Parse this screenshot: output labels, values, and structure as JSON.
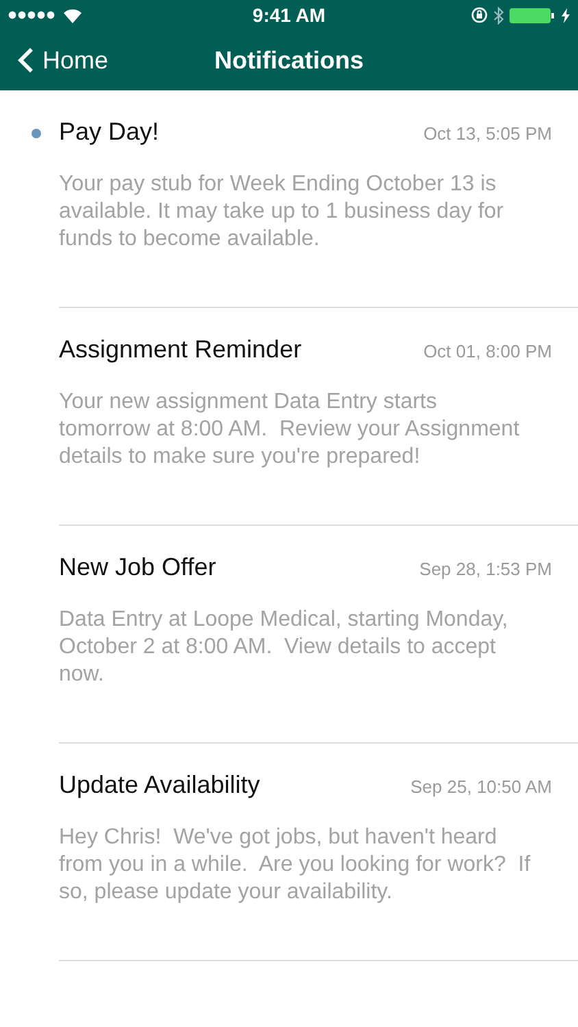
{
  "status_bar": {
    "time": "9:41 AM"
  },
  "nav_bar": {
    "back": "Home",
    "title": "Notifications"
  },
  "notifications": [
    {
      "title": "Pay Day!",
      "date": "Oct 13, 5:05 PM",
      "unread": true,
      "body": "Your pay stub for Week Ending October 13 is available. It may take up to 1 business day for funds to become available."
    },
    {
      "title": "Assignment Reminder",
      "date": "Oct 01, 8:00 PM",
      "unread": false,
      "body": "Your new assignment Data Entry starts tomorrow at 8:00 AM.  Review your Assignment details to make sure you're prepared!"
    },
    {
      "title": "New Job Offer",
      "date": "Sep 28, 1:53 PM",
      "unread": false,
      "body": "Data Entry at Loope Medical, starting Monday, October 2 at 8:00 AM.  View details to accept now."
    },
    {
      "title": "Update Availability",
      "date": "Sep 25, 10:50 AM",
      "unread": false,
      "body": "Hey Chris!  We've got jobs, but haven't heard from you in a while.  Are you looking for work?  If so, please update your availability."
    }
  ]
}
